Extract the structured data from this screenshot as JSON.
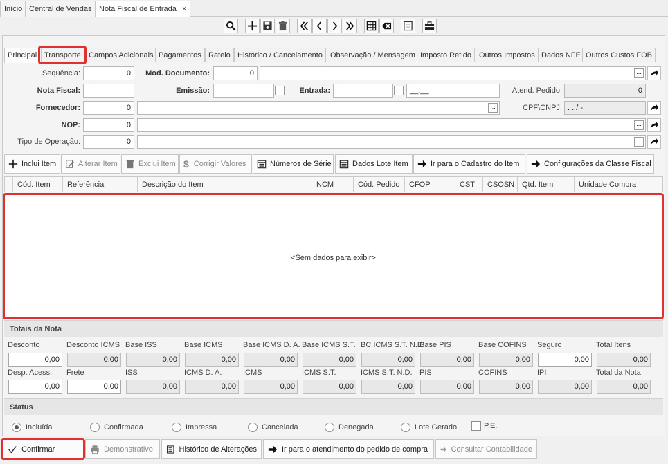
{
  "top_tabs": [
    {
      "label": "Início"
    },
    {
      "label": "Central de Vendas"
    },
    {
      "label": "Nota Fiscal de Entrada",
      "close": "×"
    }
  ],
  "form_tabs": [
    "Principal",
    "Transporte",
    "Campos Adicionais",
    "Pagamentos",
    "Rateio",
    "Histórico / Cancelamento",
    "Observação / Mensagem",
    "Imposto Retido",
    "Outros Impostos",
    "Dados NFE",
    "Outros Custos FOB"
  ],
  "fields": {
    "sequencia_label": "Sequência:",
    "sequencia_value": "0",
    "mod_documento_label": "Mod. Documento:",
    "mod_documento_value": "0",
    "nota_fiscal_label": "Nota Fiscal:",
    "emissao_label": "Emissão:",
    "entrada_label": "Entrada:",
    "entrada_time": "__:__",
    "atend_pedido_label": "Atend. Pedido:",
    "atend_pedido_value": "0",
    "fornecedor_label": "Fornecedor:",
    "fornecedor_value": "0",
    "cpf_cnpj_label": "CPF\\CNPJ:",
    "cpf_cnpj_value": ". . /  -",
    "nop_label": "NOP:",
    "nop_value": "0",
    "tipo_operacao_label": "Tipo de Operação:",
    "tipo_operacao_value": "0",
    "dots": "..."
  },
  "item_buttons": [
    "Inclui Item",
    "Alterar Item",
    "Exclui Item",
    "Corrigir Valores",
    "Números de Série",
    "Dados Lote Item",
    "Ir para o Cadastro do Item",
    "Configurações da Classe Fiscal"
  ],
  "grid": {
    "columns": [
      "Cód. Item",
      "Referência",
      "Descrição do Item",
      "NCM",
      "Cód. Pedido",
      "CFOP",
      "CST",
      "CSOSN",
      "Qtd. Item",
      "Unidade Compra"
    ],
    "empty_text": "<Sem dados para exibir>"
  },
  "totais": {
    "title": "Totais da Nota",
    "row1": [
      {
        "label": "Desconto",
        "value": "0,00"
      },
      {
        "label": "Desconto ICMS",
        "value": "0,00"
      },
      {
        "label": "Base ISS",
        "value": "0,00"
      },
      {
        "label": "Base ICMS",
        "value": "0,00"
      },
      {
        "label": "Base ICMS D. A.",
        "value": "0,00"
      },
      {
        "label": "Base ICMS S.T.",
        "value": "0,00"
      },
      {
        "label": "BC ICMS S.T. N.D.",
        "value": "0,00"
      },
      {
        "label": "Base PIS",
        "value": "0,00"
      },
      {
        "label": "Base COFINS",
        "value": "0,00"
      },
      {
        "label": "Seguro",
        "value": "0,00"
      },
      {
        "label": "Total Itens",
        "value": "0,00"
      }
    ],
    "row2": [
      {
        "label": "Desp. Acess.",
        "value": "0,00"
      },
      {
        "label": "Frete",
        "value": "0,00"
      },
      {
        "label": "ISS",
        "value": "0,00"
      },
      {
        "label": "ICMS D. A.",
        "value": "0,00"
      },
      {
        "label": "ICMS",
        "value": "0,00"
      },
      {
        "label": "ICMS S.T.",
        "value": "0,00"
      },
      {
        "label": "ICMS S.T. N.D.",
        "value": "0,00"
      },
      {
        "label": "PIS",
        "value": "0,00"
      },
      {
        "label": "COFINS",
        "value": "0,00"
      },
      {
        "label": "IPI",
        "value": "0,00"
      },
      {
        "label": "Total da Nota",
        "value": "0,00"
      }
    ]
  },
  "status": {
    "title": "Status",
    "options": [
      "Incluída",
      "Confirmada",
      "Impressa",
      "Cancelada",
      "Denegada",
      "Lote Gerado"
    ],
    "selected": "Incluída",
    "pe_label": "P.E."
  },
  "footer_buttons": [
    "Confirmar",
    "Demonstrativo",
    "Histórico de Alterações",
    "Ir para o atendimento do pedido de compra",
    "Consultar Contabilidade"
  ],
  "colors": {
    "highlight": "#e03030",
    "disabled_text": "#8a8a8a"
  }
}
